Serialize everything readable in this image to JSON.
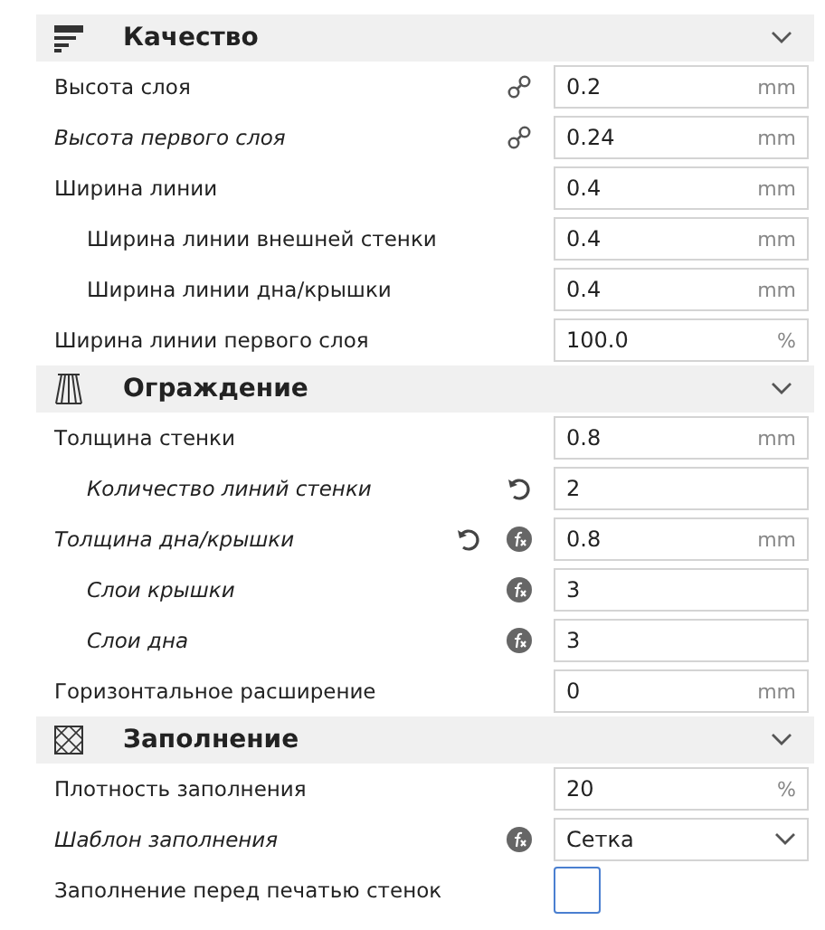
{
  "sections": [
    {
      "title": "Качество",
      "expanded": true,
      "settings": [
        {
          "label": "Высота слоя",
          "italic": false,
          "linked": true,
          "resettable": false,
          "formula": false,
          "kind": "number",
          "value": "0.2",
          "unit": "mm"
        },
        {
          "label": "Высота первого слоя",
          "italic": true,
          "linked": true,
          "resettable": false,
          "formula": false,
          "kind": "number",
          "value": "0.24",
          "unit": "mm"
        },
        {
          "label": "Ширина линии",
          "italic": false,
          "linked": false,
          "resettable": false,
          "formula": false,
          "kind": "number",
          "value": "0.4",
          "unit": "mm",
          "children": [
            {
              "label": "Ширина линии внешней стенки",
              "italic": false,
              "linked": false,
              "resettable": false,
              "formula": false,
              "kind": "number",
              "value": "0.4",
              "unit": "mm"
            },
            {
              "label": "Ширина линии дна/крышки",
              "italic": false,
              "linked": false,
              "resettable": false,
              "formula": false,
              "kind": "number",
              "value": "0.4",
              "unit": "mm"
            }
          ]
        },
        {
          "label": "Ширина линии первого слоя",
          "italic": false,
          "linked": false,
          "resettable": false,
          "formula": false,
          "kind": "number",
          "value": "100.0",
          "unit": "%"
        }
      ]
    },
    {
      "title": "Ограждение",
      "expanded": true,
      "settings": [
        {
          "label": "Толщина стенки",
          "italic": false,
          "linked": false,
          "resettable": false,
          "formula": false,
          "kind": "number",
          "value": "0.8",
          "unit": "mm",
          "children": [
            {
              "label": "Количество линий стенки",
              "italic": true,
              "linked": false,
              "resettable": true,
              "formula": false,
              "kind": "number",
              "value": "2"
            }
          ]
        },
        {
          "label": "Толщина дна/крышки",
          "italic": true,
          "linked": false,
          "resettable": true,
          "formula": true,
          "kind": "number",
          "value": "0.8",
          "unit": "mm",
          "children": [
            {
              "label": "Слои крышки",
              "italic": true,
              "linked": false,
              "resettable": false,
              "formula": true,
              "kind": "number",
              "value": "3"
            },
            {
              "label": "Слои дна",
              "italic": true,
              "linked": false,
              "resettable": false,
              "formula": true,
              "kind": "number",
              "value": "3"
            }
          ]
        },
        {
          "label": "Горизонтальное расширение",
          "italic": false,
          "linked": false,
          "resettable": false,
          "formula": false,
          "kind": "number",
          "value": "0",
          "unit": "mm"
        }
      ]
    },
    {
      "title": "Заполнение",
      "expanded": true,
      "settings": [
        {
          "label": "Плотность заполнения",
          "italic": false,
          "linked": false,
          "resettable": false,
          "formula": false,
          "kind": "number",
          "value": "20",
          "unit": "%"
        },
        {
          "label": "Шаблон заполнения",
          "italic": true,
          "linked": false,
          "resettable": false,
          "formula": true,
          "kind": "dropdown",
          "value": "Сетка"
        },
        {
          "label": "Заполнение перед печатью стенок",
          "italic": false,
          "linked": false,
          "resettable": false,
          "formula": false,
          "kind": "checkbox",
          "checked": false
        }
      ]
    }
  ]
}
